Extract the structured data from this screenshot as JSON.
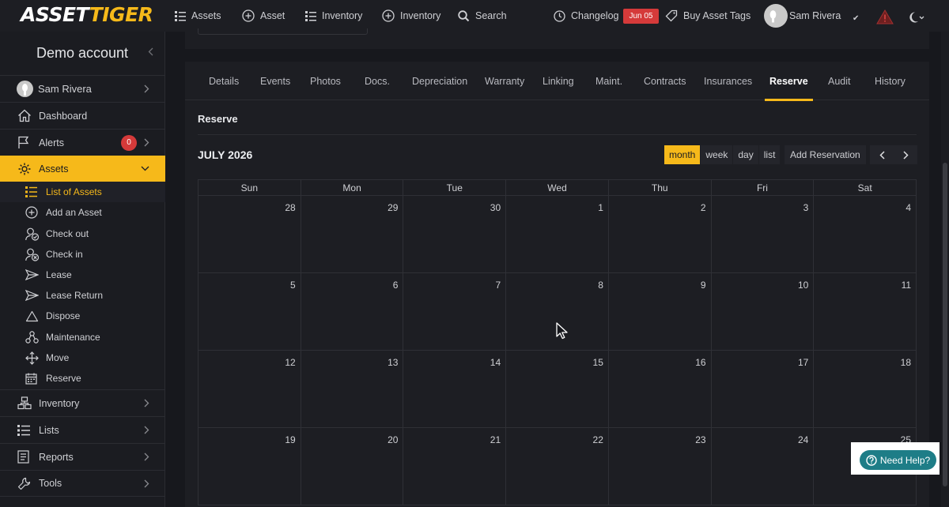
{
  "brand": {
    "part1": "ASSET",
    "part2": "TIGER"
  },
  "topnav": {
    "assets": "Assets",
    "add_asset": "Asset",
    "inventory": "Inventory",
    "add_inventory": "Inventory",
    "search": "Search",
    "changelog": "Changelog",
    "changelog_date": "Jun 05",
    "buy_tags": "Buy Asset Tags",
    "user": "Sam Rivera"
  },
  "sidebar": {
    "account": "Demo account",
    "user": "Sam Rivera",
    "dashboard": "Dashboard",
    "alerts": "Alerts",
    "alerts_count": "0",
    "assets": "Assets",
    "asset_items": [
      "List of Assets",
      "Add an Asset",
      "Check out",
      "Check in",
      "Lease",
      "Lease Return",
      "Dispose",
      "Maintenance",
      "Move",
      "Reserve"
    ],
    "inventory": "Inventory",
    "lists": "Lists",
    "reports": "Reports",
    "tools": "Tools"
  },
  "tabs": [
    "Details",
    "Events",
    "Photos",
    "Docs.",
    "Depreciation",
    "Warranty",
    "Linking",
    "Maint.",
    "Contracts",
    "Insurances",
    "Reserve",
    "Audit",
    "History"
  ],
  "active_tab": "Reserve",
  "section_title": "Reserve",
  "calendar": {
    "title": "JULY 2026",
    "views": [
      "month",
      "week",
      "day",
      "list"
    ],
    "active_view": "month",
    "add_reservation": "Add Reservation",
    "weekdays": [
      "Sun",
      "Mon",
      "Tue",
      "Wed",
      "Thu",
      "Fri",
      "Sat"
    ],
    "weeks": [
      [
        "28",
        "29",
        "30",
        "1",
        "2",
        "3",
        "4"
      ],
      [
        "5",
        "6",
        "7",
        "8",
        "9",
        "10",
        "11"
      ],
      [
        "12",
        "13",
        "14",
        "15",
        "16",
        "17",
        "18"
      ],
      [
        "19",
        "20",
        "21",
        "22",
        "23",
        "24",
        "25"
      ]
    ]
  },
  "help": "Need Help?",
  "colors": {
    "accent": "#f6b91a",
    "danger": "#d53a3a",
    "help": "#1e7d87"
  }
}
